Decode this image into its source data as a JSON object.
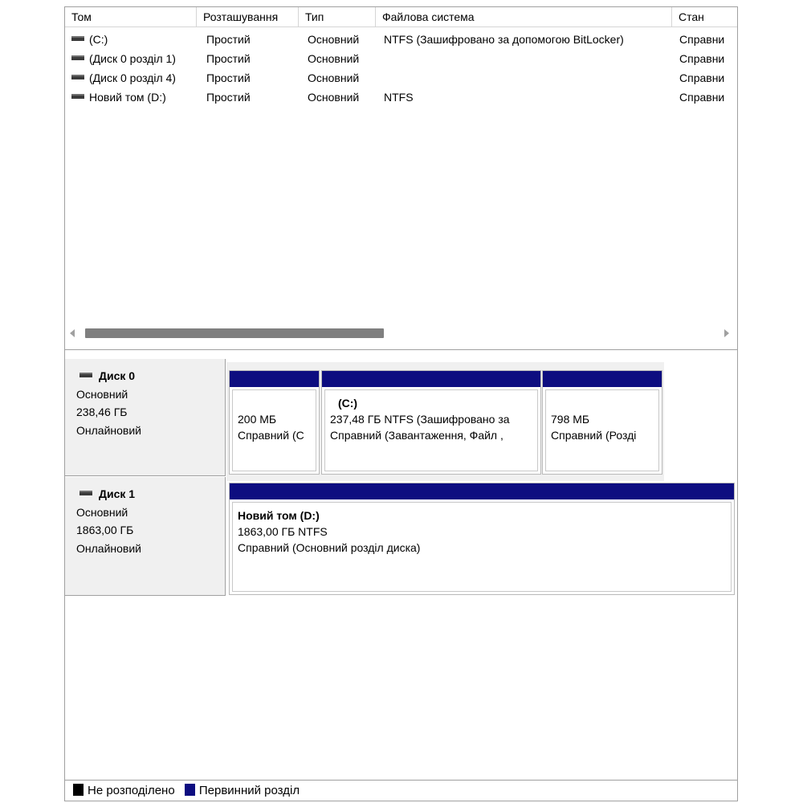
{
  "columns": [
    "Том",
    "Розташування",
    "Тип",
    "Файлова система",
    "Стан"
  ],
  "volumes": [
    {
      "name": "(C:)",
      "layout": "Простий",
      "type": "Основний",
      "fs": "NTFS (Зашифровано за допомогою BitLocker)",
      "status": "Справни"
    },
    {
      "name": "(Диск 0 розділ 1)",
      "layout": "Простий",
      "type": "Основний",
      "fs": "",
      "status": "Справни"
    },
    {
      "name": "(Диск 0 розділ 4)",
      "layout": "Простий",
      "type": "Основний",
      "fs": "",
      "status": "Справни"
    },
    {
      "name": "Новий том (D:)",
      "layout": "Простий",
      "type": "Основний",
      "fs": "NTFS",
      "status": "Справни"
    }
  ],
  "disks": [
    {
      "title": "Диск 0",
      "kind": "Основний",
      "size": "238,46 ГБ",
      "state": "Онлайновий",
      "partitions": [
        {
          "name": "",
          "line1": "200 МБ",
          "line2": "Справний (С"
        },
        {
          "name": "(C:)",
          "line1": "237,48 ГБ NTFS (Зашифровано за",
          "line2": "Справний (Завантаження, Файл ,"
        },
        {
          "name": "",
          "line1": "798 МБ",
          "line2": "Справний (Розді"
        }
      ]
    },
    {
      "title": "Диск 1",
      "kind": "Основний",
      "size": "1863,00 ГБ",
      "state": "Онлайновий",
      "partitions": [
        {
          "name": "Новий том  (D:)",
          "line1": "1863,00 ГБ NTFS",
          "line2": "Справний (Основний розділ диска)"
        }
      ]
    }
  ],
  "legend": [
    {
      "label": "Не розподілено",
      "color": "#000000"
    },
    {
      "label": "Первинний розділ",
      "color": "#0d0d80"
    }
  ],
  "colors": {
    "partition_bar": "#0d0d80",
    "disk_panel_bg": "#f0f0f0"
  },
  "icons": {
    "drive": "drive-icon",
    "scroll_left": "scroll-left-arrow-icon",
    "scroll_right": "scroll-right-arrow-icon"
  }
}
